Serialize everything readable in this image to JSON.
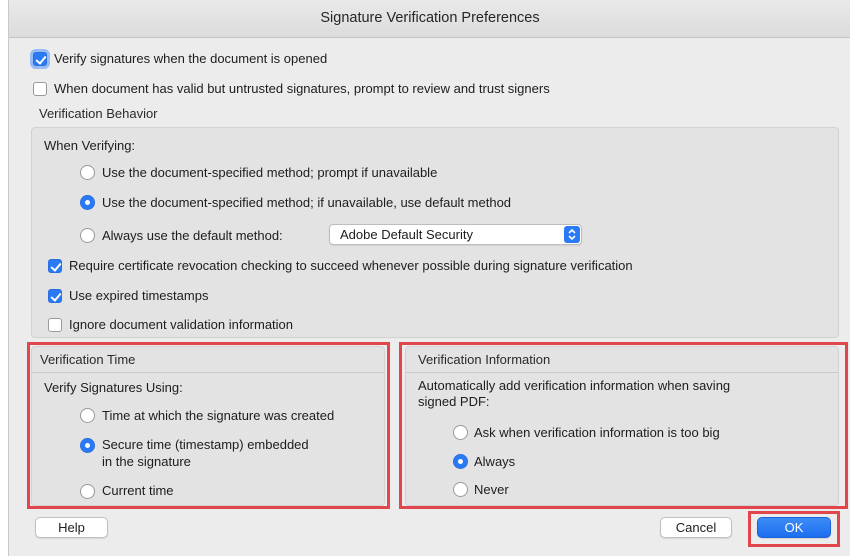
{
  "window": {
    "title": "Signature Verification Preferences"
  },
  "top": {
    "verify_on_open": {
      "label": "Verify signatures when the document is opened",
      "checked": true
    },
    "prompt_untrusted": {
      "label": "When document has valid but untrusted signatures, prompt to review and trust signers",
      "checked": false
    }
  },
  "behavior": {
    "heading": "Verification Behavior",
    "when_verifying": "When Verifying:",
    "options": [
      {
        "label": "Use the document-specified method; prompt if unavailable",
        "selected": false
      },
      {
        "label": "Use the document-specified method; if unavailable, use default method",
        "selected": true
      },
      {
        "label": "Always use the default method:",
        "selected": false
      }
    ],
    "default_method_value": "Adobe Default Security",
    "checks": [
      {
        "label": "Require certificate revocation checking to succeed whenever possible during signature verification",
        "checked": true
      },
      {
        "label": "Use expired timestamps",
        "checked": true
      },
      {
        "label": "Ignore document validation information",
        "checked": false
      }
    ]
  },
  "time": {
    "heading": "Verification Time",
    "subheading": "Verify Signatures Using:",
    "options": [
      {
        "label": "Time at which the signature was created",
        "selected": false
      },
      {
        "line1": "Secure time (timestamp) embedded",
        "line2": "in the signature",
        "selected": true
      },
      {
        "label": "Current time",
        "selected": false
      }
    ]
  },
  "info": {
    "heading": "Verification Information",
    "desc_line1": "Automatically add verification information when saving",
    "desc_line2": "signed PDF:",
    "options": [
      {
        "label": "Ask when verification information is too big",
        "selected": false
      },
      {
        "label": "Always",
        "selected": true
      },
      {
        "label": "Never",
        "selected": false
      }
    ]
  },
  "buttons": {
    "help": "Help",
    "cancel": "Cancel",
    "ok": "OK"
  },
  "colors": {
    "accent": "#2a7af5",
    "highlight": "#e0464b"
  }
}
